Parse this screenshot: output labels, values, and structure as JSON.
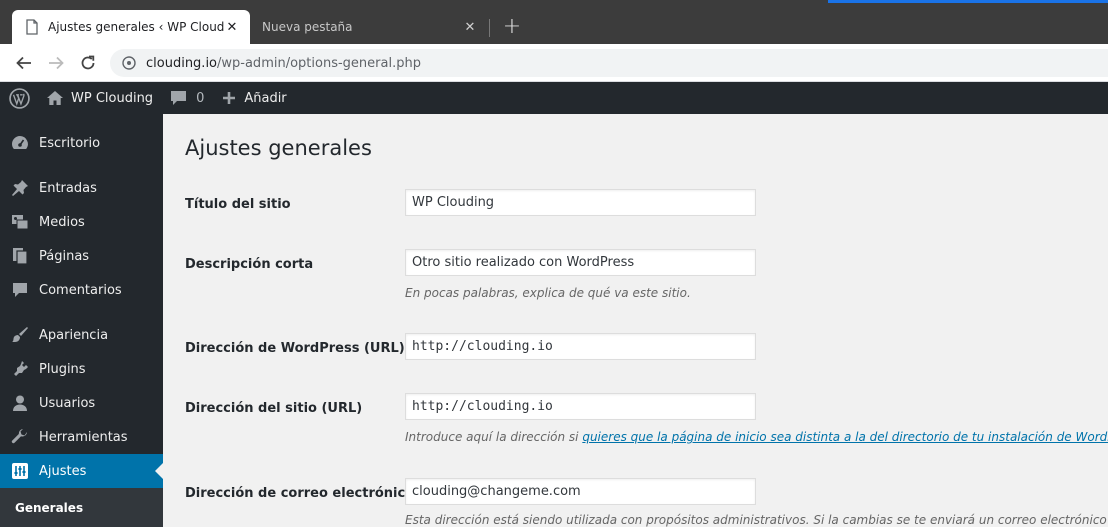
{
  "browser": {
    "tabs": [
      {
        "title": "Ajustes generales ‹ WP Clouding",
        "active": true
      },
      {
        "title": "Nueva pestaña",
        "active": false
      }
    ],
    "url_domain": "clouding.io",
    "url_path": "/wp-admin/options-general.php"
  },
  "adminbar": {
    "site_name": "WP Clouding",
    "comments_count": "0",
    "new_label": "Añadir"
  },
  "sidebar": {
    "items": [
      {
        "label": "Escritorio",
        "icon": "dashboard-icon"
      },
      {
        "label": "Entradas",
        "icon": "pushpin-icon"
      },
      {
        "label": "Medios",
        "icon": "media-icon"
      },
      {
        "label": "Páginas",
        "icon": "pages-icon"
      },
      {
        "label": "Comentarios",
        "icon": "comment-icon"
      },
      {
        "label": "Apariencia",
        "icon": "brush-icon"
      },
      {
        "label": "Plugins",
        "icon": "plug-icon"
      },
      {
        "label": "Usuarios",
        "icon": "user-icon"
      },
      {
        "label": "Herramientas",
        "icon": "wrench-icon"
      },
      {
        "label": "Ajustes",
        "icon": "settings-icon",
        "current": true
      }
    ],
    "submenu": {
      "label": "Generales"
    }
  },
  "page": {
    "title": "Ajustes generales",
    "fields": [
      {
        "label": "Título del sitio",
        "value": "WP Clouding"
      },
      {
        "label": "Descripción corta",
        "value": "Otro sitio realizado con WordPress",
        "description": "En pocas palabras, explica de qué va este sitio."
      },
      {
        "label": "Dirección de WordPress (URL)",
        "value": "http://clouding.io"
      },
      {
        "label": "Dirección del sitio (URL)",
        "value": "http://clouding.io",
        "description_prefix": "Introduce aquí la dirección si ",
        "description_link": "quieres que la página de inicio sea distinta a la del directorio de tu instalación de WordPress"
      },
      {
        "label": "Dirección de correo electrónico",
        "value": "clouding@changeme.com",
        "description": "Esta dirección está siendo utilizada con propósitos administrativos. Si la cambias se te enviará un correo electrónico a tu nueva dirección para confirmarla."
      }
    ]
  },
  "colors": {
    "admin_dark": "#23282d",
    "admin_blue": "#0073aa",
    "content_bg": "#f1f1f1"
  }
}
